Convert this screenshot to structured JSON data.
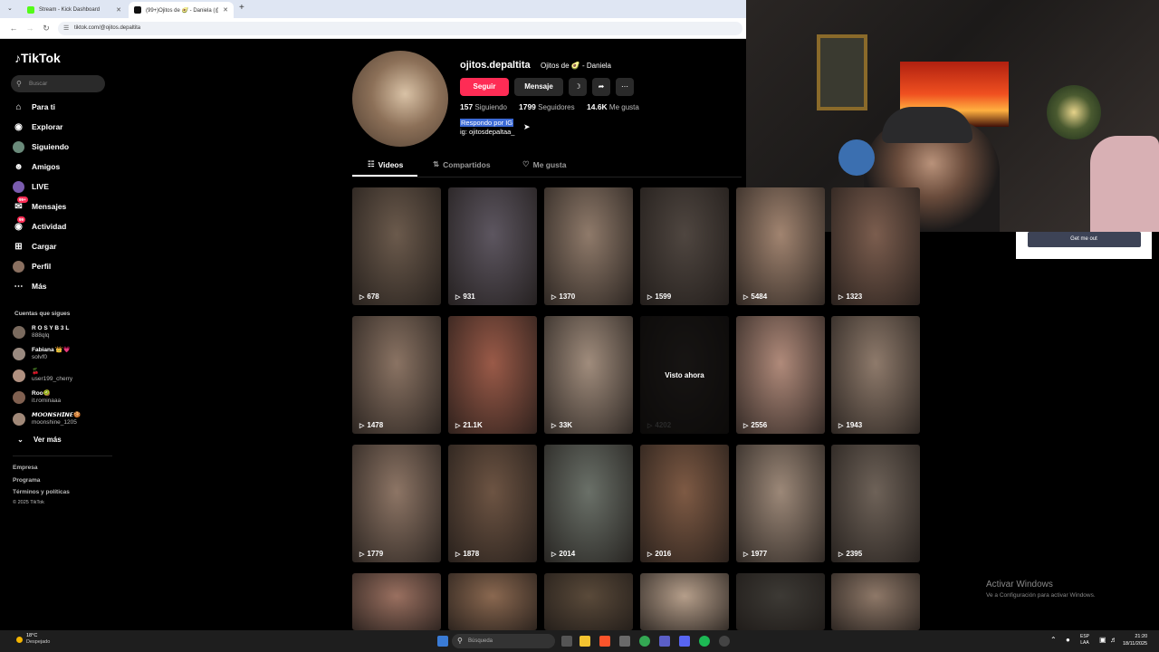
{
  "browser": {
    "tabs": [
      {
        "title": "Stream - Kick Dashboard",
        "favicon_color": "#53fc18"
      },
      {
        "title": "(99+)Ojitos de 🥑 - Daniela (@...",
        "favicon_color": "#111111"
      }
    ],
    "new_tab": "+",
    "url": "tiktok.com/@ojitos.depaltita"
  },
  "sidebar": {
    "logo": "TikTok",
    "search_placeholder": "Buscar",
    "nav": [
      {
        "label": "Para ti",
        "icon": "home-icon"
      },
      {
        "label": "Explorar",
        "icon": "compass-icon"
      },
      {
        "label": "Siguiendo",
        "icon": "following-icon"
      },
      {
        "label": "Amigos",
        "icon": "friends-icon"
      },
      {
        "label": "LIVE",
        "icon": "live-icon"
      },
      {
        "label": "Mensajes",
        "icon": "messages-icon",
        "badge": "99+"
      },
      {
        "label": "Actividad",
        "icon": "activity-icon",
        "badge": "99"
      },
      {
        "label": "Cargar",
        "icon": "upload-icon"
      },
      {
        "label": "Perfil",
        "icon": "profile-icon"
      },
      {
        "label": "Más",
        "icon": "more-icon"
      }
    ],
    "following_title": "Cuentas que sigues",
    "accounts": [
      {
        "name": "R O S Y B 3 L",
        "handle": "888qlq"
      },
      {
        "name": "Fabiana 👑💗",
        "handle": "solvf0"
      },
      {
        "name": "🍒",
        "handle": "user199_cherry"
      },
      {
        "name": "Roo🥝",
        "handle": "it.rominaaa"
      },
      {
        "name": "𝙈𝙊𝙊𝙉𝙎𝙃𝙄𝙉𝙀🍪",
        "handle": "moonshine_1205"
      }
    ],
    "see_more": "Ver más",
    "footer": [
      "Empresa",
      "Programa",
      "Términos y políticas",
      "© 2025 TikTok"
    ]
  },
  "profile": {
    "username": "ojitos.depaltita",
    "nickname": "Ojitos de 🥑 - Daniela",
    "follow_label": "Seguir",
    "message_label": "Mensaje",
    "following_count": "157",
    "following_label": "Siguiendo",
    "followers_count": "1799",
    "followers_label": "Seguidores",
    "likes_count": "14.6K",
    "likes_label": "Me gusta",
    "bio_line1": "Respondo por IG",
    "bio_line2": "ig: ojitosdepaltaa_",
    "tabs": [
      "Videos",
      "Compartidos",
      "Me gusta"
    ]
  },
  "videos": [
    {
      "views": "678",
      "tone": "#6b5a4c"
    },
    {
      "views": "931",
      "tone": "#5d5660"
    },
    {
      "views": "1370",
      "tone": "#8f7a6a"
    },
    {
      "views": "1599",
      "tone": "#4f4640"
    },
    {
      "views": "5484",
      "tone": "#a18470"
    },
    {
      "views": "1323",
      "tone": "#7b5d4e"
    },
    {
      "views": "1478",
      "tone": "#8a7363"
    },
    {
      "views": "21.1K",
      "tone": "#9a5a48"
    },
    {
      "views": "33K",
      "tone": "#a08c7c"
    },
    {
      "views": "4202",
      "tone": "#3a3431",
      "watched": "Visto ahora"
    },
    {
      "views": "2556",
      "tone": "#b08a7a"
    },
    {
      "views": "1943",
      "tone": "#8e7a6b"
    },
    {
      "views": "1779",
      "tone": "#8d7565"
    },
    {
      "views": "1878",
      "tone": "#6d5443"
    },
    {
      "views": "2014",
      "tone": "#6a7068"
    },
    {
      "views": "2016",
      "tone": "#7e5a44"
    },
    {
      "views": "1977",
      "tone": "#9c8878"
    },
    {
      "views": "2395",
      "tone": "#6e6258"
    },
    {
      "views": "",
      "tone": "#9a7060"
    },
    {
      "views": "",
      "tone": "#8a6850"
    },
    {
      "views": "",
      "tone": "#5a4a3a"
    },
    {
      "views": "",
      "tone": "#b59e8a"
    },
    {
      "views": "",
      "tone": "#3d3a35"
    },
    {
      "views": "",
      "tone": "#8e7868"
    }
  ],
  "overlay": {
    "get_me_out": "Get me out",
    "activate_title": "Activar Windows",
    "activate_sub": "Ve a Configuración para activar Windows."
  },
  "taskbar": {
    "temp": "18°C",
    "weather": "Despejado",
    "search_placeholder": "Búsqueda",
    "lang1": "ESP",
    "lang2": "LAA",
    "time": "21:20",
    "date": "18/11/2025"
  }
}
